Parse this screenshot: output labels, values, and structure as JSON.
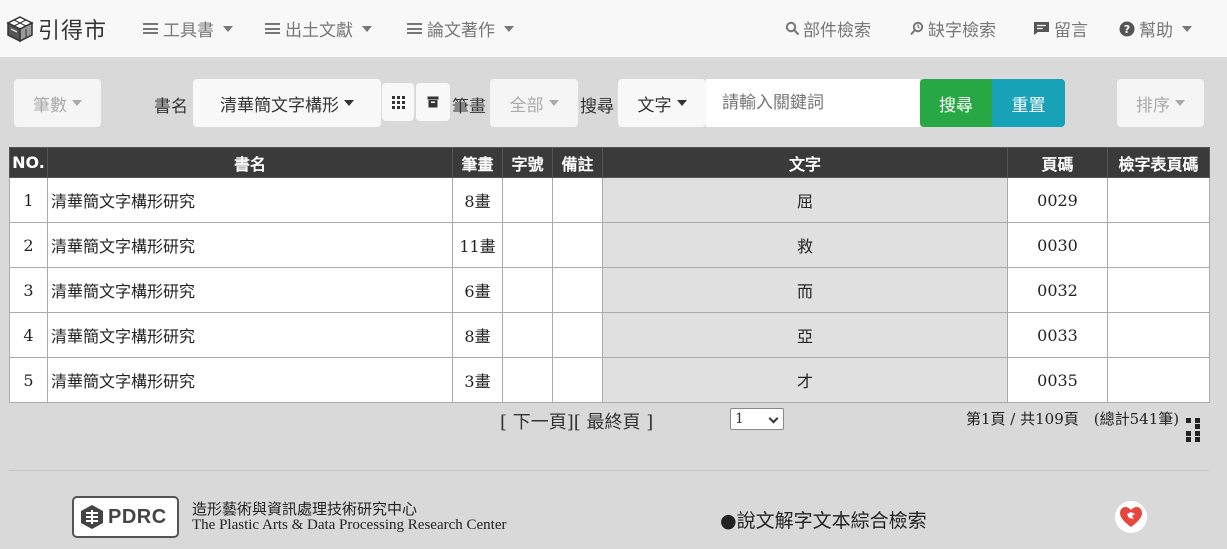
{
  "nav": {
    "brand": "引得市",
    "menus": [
      {
        "label": "工具書"
      },
      {
        "label": "出土文獻"
      },
      {
        "label": "論文著作"
      }
    ],
    "right": [
      {
        "label": "部件檢索",
        "icon": "search-icon"
      },
      {
        "label": "缺字檢索",
        "icon": "search-history-icon"
      },
      {
        "label": "留言",
        "icon": "chat-icon"
      },
      {
        "label": "幫助",
        "icon": "help-icon"
      }
    ]
  },
  "toolbar": {
    "strokes_filter": "筆數",
    "book_label": "書名",
    "book_value": "清華簡文字構形",
    "stroke_label": "筆畫",
    "stroke_value": "全部",
    "search_label": "搜尋",
    "search_type": "文字",
    "search_placeholder": "請輸入關鍵詞",
    "search_button": "搜尋",
    "reset_button": "重置",
    "sort_button": "排序"
  },
  "table": {
    "headers": [
      "NO.",
      "書名",
      "筆畫",
      "字號",
      "備註",
      "文字",
      "頁碼",
      "檢字表頁碼"
    ],
    "rows": [
      {
        "no": "1",
        "title": "清華簡文字構形研究",
        "strokes": "8畫",
        "num": "",
        "note": "",
        "char": "屈",
        "page": "0029",
        "index_page": ""
      },
      {
        "no": "2",
        "title": "清華簡文字構形研究",
        "strokes": "11畫",
        "num": "",
        "note": "",
        "char": "救",
        "page": "0030",
        "index_page": ""
      },
      {
        "no": "3",
        "title": "清華簡文字構形研究",
        "strokes": "6畫",
        "num": "",
        "note": "",
        "char": "而",
        "page": "0032",
        "index_page": ""
      },
      {
        "no": "4",
        "title": "清華簡文字構形研究",
        "strokes": "8畫",
        "num": "",
        "note": "",
        "char": "亞",
        "page": "0033",
        "index_page": ""
      },
      {
        "no": "5",
        "title": "清華簡文字構形研究",
        "strokes": "3畫",
        "num": "",
        "note": "",
        "char": "才",
        "page": "0035",
        "index_page": ""
      }
    ]
  },
  "pagination": {
    "next": "[ 下一頁]",
    "last": "[ 最終頁 ]",
    "selected_page": "1",
    "info": "第1頁 / 共109頁　(總計541筆)"
  },
  "footer": {
    "logo_text": "PDRC",
    "org_zh": "造形藝術與資訊處理技術研究中心",
    "org_en": "The Plastic Arts & Data Processing Research Center",
    "link": "●說文解字文本綜合檢索"
  },
  "colors": {
    "search_button": "#28a745",
    "reset_button": "#17a2b8",
    "header_bg": "#3a3a3a",
    "heart": "#e8453c"
  }
}
